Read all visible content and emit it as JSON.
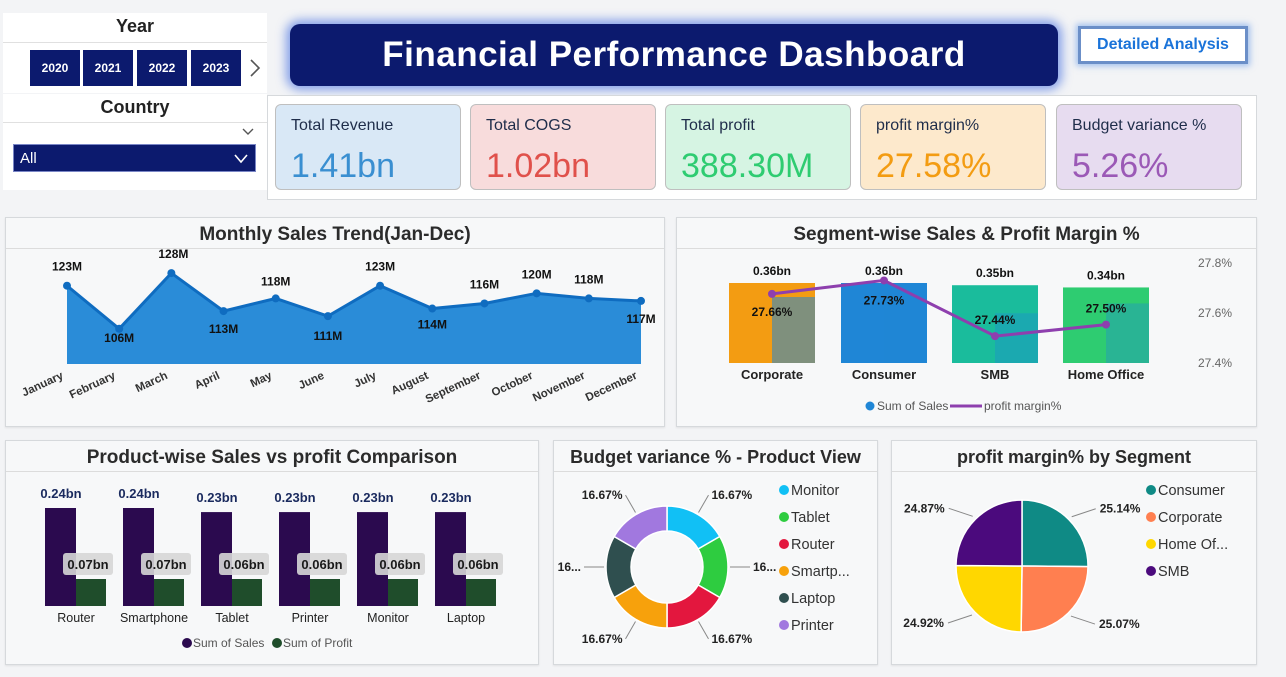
{
  "slicers": {
    "year_title": "Year",
    "years": [
      "2020",
      "2021",
      "2022",
      "2023"
    ],
    "country_title": "Country",
    "country_value": "All"
  },
  "header": {
    "title": "Financial Performance Dashboard",
    "detail_button": "Detailed Analysis"
  },
  "kpis": [
    {
      "label": "Total Revenue",
      "value": "1.41bn",
      "bg": "#d9e8f6",
      "color": "#3a8fd1"
    },
    {
      "label": "Total COGS",
      "value": "1.02bn",
      "bg": "#f8dcdc",
      "color": "#e0514b"
    },
    {
      "label": "Total profit",
      "value": "388.30M",
      "bg": "#d6f4e3",
      "color": "#2ecc71"
    },
    {
      "label": "profit margin%",
      "value": "27.58%",
      "bg": "#fde9cc",
      "color": "#f39c12"
    },
    {
      "label": "Budget variance %",
      "value": "5.26%",
      "bg": "#e7dcf0",
      "color": "#9b59b6"
    }
  ],
  "chart_data": [
    {
      "type": "area",
      "title": "Monthly Sales Trend(Jan-Dec)",
      "categories": [
        "January",
        "February",
        "March",
        "April",
        "May",
        "June",
        "July",
        "August",
        "September",
        "October",
        "November",
        "December"
      ],
      "values": [
        123,
        106,
        128,
        113,
        118,
        111,
        123,
        114,
        116,
        120,
        118,
        117
      ],
      "labels": [
        "123M",
        "106M",
        "128M",
        "113M",
        "118M",
        "111M",
        "123M",
        "114M",
        "116M",
        "120M",
        "118M",
        "117M"
      ],
      "color": "#1f86d6"
    },
    {
      "type": "bar",
      "title": "Segment-wise Sales & Profit Margin %",
      "categories": [
        "Corporate",
        "Consumer",
        "SMB",
        "Home Office"
      ],
      "series": [
        {
          "name": "Sum of Sales",
          "values": [
            0.36,
            0.36,
            0.35,
            0.34
          ],
          "labels": [
            "0.36bn",
            "0.36bn",
            "0.35bn",
            "0.34bn"
          ]
        },
        {
          "name": "profit margin%",
          "values": [
            27.66,
            27.73,
            27.44,
            27.5
          ],
          "labels": [
            "27.66%",
            "27.73%",
            "27.44%",
            "27.50%"
          ]
        }
      ],
      "bar_colors": [
        "#f39c12",
        "#1f86d6",
        "#1abc9c",
        "#2ecc71"
      ],
      "y2_ticks": [
        "27.8%",
        "27.6%",
        "27.4%"
      ]
    },
    {
      "type": "bar",
      "title": "Product-wise Sales vs profit Comparison",
      "categories": [
        "Router",
        "Smartphone",
        "Tablet",
        "Printer",
        "Monitor",
        "Laptop"
      ],
      "series": [
        {
          "name": "Sum of Sales",
          "values": [
            0.24,
            0.24,
            0.23,
            0.23,
            0.23,
            0.23
          ],
          "labels": [
            "0.24bn",
            "0.24bn",
            "0.23bn",
            "0.23bn",
            "0.23bn",
            "0.23bn"
          ],
          "color": "#2b0a4f"
        },
        {
          "name": "Sum of Profit",
          "values": [
            0.07,
            0.07,
            0.06,
            0.06,
            0.06,
            0.06
          ],
          "labels": [
            "0.07bn",
            "0.07bn",
            "0.06bn",
            "0.06bn",
            "0.06bn",
            "0.06bn"
          ],
          "color": "#1f4d2b"
        }
      ]
    },
    {
      "type": "pie",
      "title": "Budget variance % - Product View",
      "categories": [
        "Monitor",
        "Tablet",
        "Router",
        "Smartp...",
        "Laptop",
        "Printer"
      ],
      "values": [
        16.67,
        16.67,
        16.67,
        16.67,
        16.67,
        16.67
      ],
      "labels": [
        "16.67%",
        "16...",
        "16.67%",
        "16.67%",
        "16...",
        "16.67%"
      ],
      "colors": [
        "#11c0f5",
        "#2ecc40",
        "#e3173e",
        "#f7a10c",
        "#2f4f4f",
        "#a178df"
      ]
    },
    {
      "type": "pie",
      "title": "profit margin% by Segment",
      "categories": [
        "Consumer",
        "Corporate",
        "Home Of...",
        "SMB"
      ],
      "values": [
        25.14,
        25.07,
        24.92,
        24.87
      ],
      "labels": [
        "25.14%",
        "25.07%",
        "24.92%",
        "24.87%"
      ],
      "colors": [
        "#0f8a85",
        "#ff7f50",
        "#ffd700",
        "#4b0a7d"
      ]
    }
  ]
}
